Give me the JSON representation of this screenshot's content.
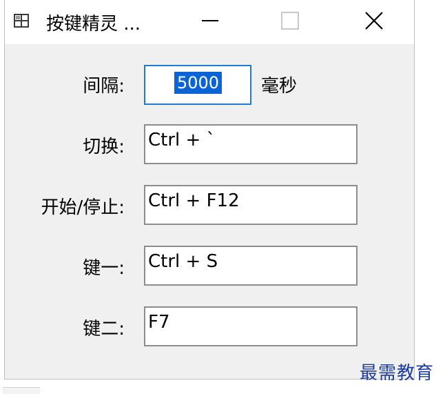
{
  "window": {
    "title": "按键精灵 ...",
    "icon": "app-grid-icon",
    "controls": {
      "minimize_icon": "minimize-icon",
      "maximize_icon": "maximize-icon",
      "close_icon": "close-icon"
    }
  },
  "form": {
    "interval": {
      "label": "间隔:",
      "value": "5000",
      "unit": "毫秒"
    },
    "rows": [
      {
        "label": "切换:",
        "value": "Ctrl + `"
      },
      {
        "label": "开始/停止:",
        "value": "Ctrl + F12"
      },
      {
        "label": "键一:",
        "value": "Ctrl + S"
      },
      {
        "label": "键二:",
        "value": "F7"
      }
    ]
  },
  "watermark": {
    "text": "最需教育"
  },
  "colors": {
    "selection": "#0a64d6",
    "focus_border": "#1e7ad7",
    "window_bg": "#f0f0f0",
    "watermark": "#1e3ca0"
  }
}
